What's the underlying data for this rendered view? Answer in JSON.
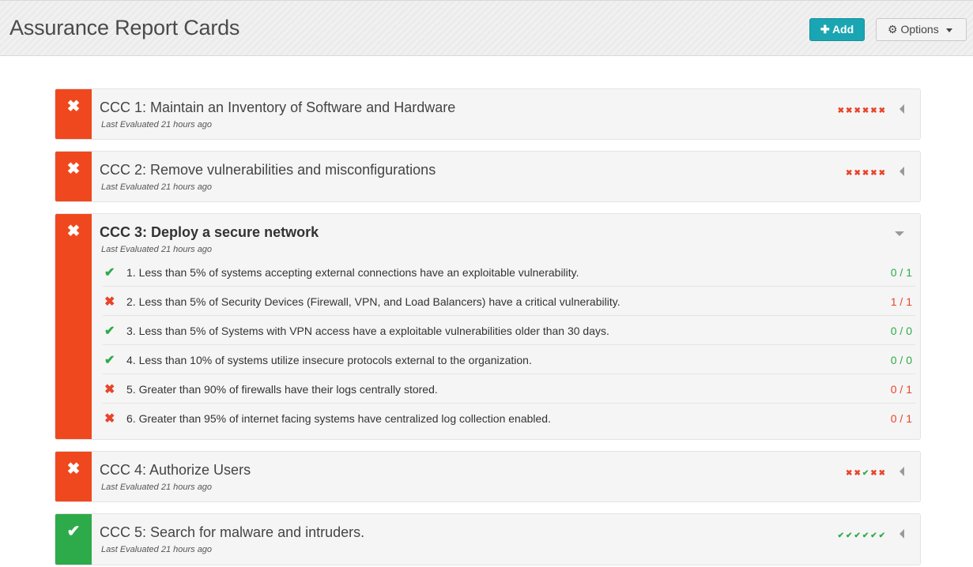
{
  "header": {
    "title": "Assurance Report Cards",
    "add_label": "Add",
    "options_label": "Options"
  },
  "cards": [
    {
      "status": "fail",
      "title": "CCC 1: Maintain an Inventory of Software and Hardware",
      "subtitle": "Last Evaluated 21 hours ago",
      "summary": [
        "x",
        "x",
        "x",
        "x",
        "x",
        "x"
      ]
    },
    {
      "status": "fail",
      "title": "CCC 2: Remove vulnerabilities and misconfigurations",
      "subtitle": "Last Evaluated 21 hours ago",
      "summary": [
        "x",
        "x",
        "x",
        "x",
        "x"
      ]
    },
    {
      "status": "fail",
      "title": "CCC 3: Deploy a secure network",
      "subtitle": "Last Evaluated 21 hours ago",
      "expanded": true,
      "criteria": [
        {
          "result": "pass",
          "text": "1. Less than 5% of systems accepting external connections have an exploitable vulnerability.",
          "score": "0 / 1"
        },
        {
          "result": "fail",
          "text": "2. Less than 5% of Security Devices (Firewall, VPN, and Load Balancers) have a critical vulnerability.",
          "score": "1 / 1"
        },
        {
          "result": "pass",
          "text": "3. Less than 5% of Systems with VPN access have a exploitable vulnerabilities older than 30 days.",
          "score": "0 / 0"
        },
        {
          "result": "pass",
          "text": "4. Less than 10% of systems utilize insecure protocols external to the organization.",
          "score": "0 / 0"
        },
        {
          "result": "fail",
          "text": "5. Greater than 90% of firewalls have their logs centrally stored.",
          "score": "0 / 1"
        },
        {
          "result": "fail",
          "text": "6. Greater than 95% of internet facing systems have centralized log collection enabled.",
          "score": "0 / 1"
        }
      ]
    },
    {
      "status": "fail",
      "title": "CCC 4: Authorize Users",
      "subtitle": "Last Evaluated 21 hours ago",
      "summary": [
        "x",
        "x",
        "c",
        "x",
        "x"
      ]
    },
    {
      "status": "pass",
      "title": "CCC 5: Search for malware and intruders.",
      "subtitle": "Last Evaluated 21 hours ago",
      "summary": [
        "c",
        "c",
        "c",
        "c",
        "c",
        "c"
      ]
    }
  ],
  "colors": {
    "fail": "#f0481e",
    "pass": "#2dab4a",
    "accent": "#1aa5b3"
  },
  "icons": {
    "fail": "close-icon",
    "pass": "check-icon",
    "add": "plus-icon",
    "options": "gear-icon"
  }
}
